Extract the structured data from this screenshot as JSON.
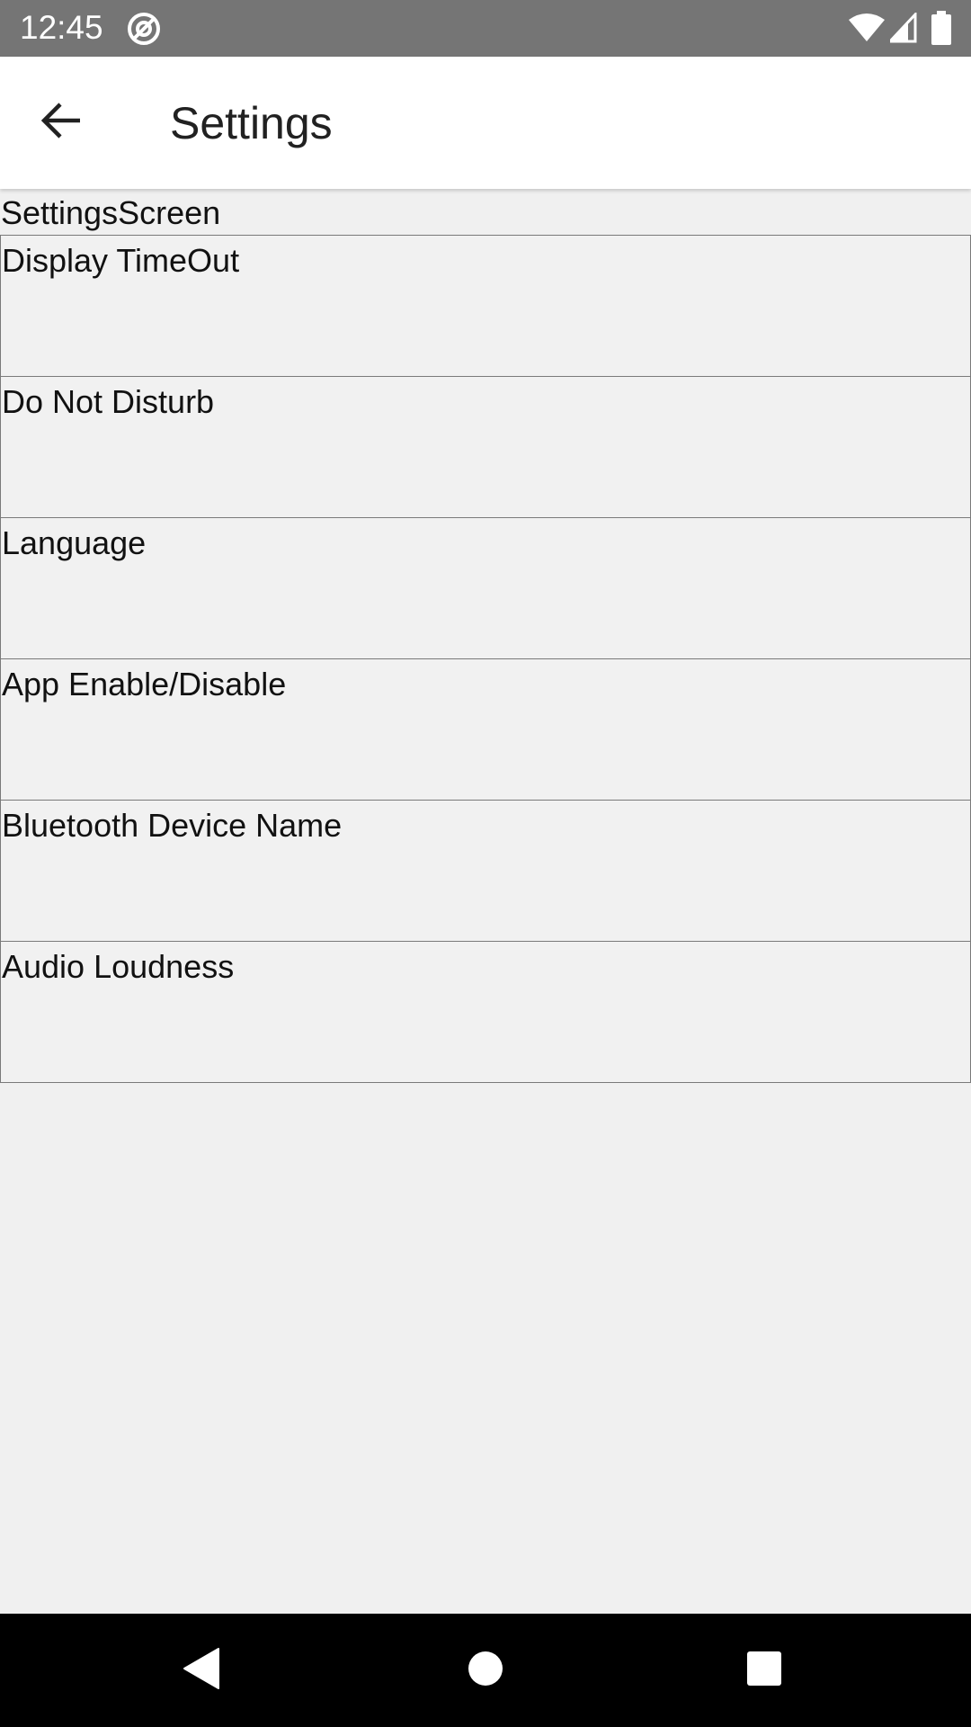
{
  "status_bar": {
    "time": "12:45",
    "icons": [
      "at-sign-icon",
      "wifi-icon",
      "cellular-signal-icon",
      "battery-icon"
    ]
  },
  "app_bar": {
    "back_icon": "arrow-back-icon",
    "title": "Settings"
  },
  "screen_label": "SettingsScreen",
  "settings": {
    "items": [
      {
        "label": "Display TimeOut"
      },
      {
        "label": "Do Not Disturb"
      },
      {
        "label": "Language"
      },
      {
        "label": "App Enable/Disable"
      },
      {
        "label": "Bluetooth Device Name"
      },
      {
        "label": "Audio Loudness"
      }
    ]
  },
  "nav_bar": {
    "icons": [
      "nav-back-icon",
      "nav-home-icon",
      "nav-recents-icon"
    ]
  },
  "colors": {
    "status_bar_bg": "#757575",
    "app_bar_bg": "#ffffff",
    "content_bg": "#f0f0f0",
    "nav_bar_bg": "#000000",
    "divider": "#7a7a7a"
  }
}
